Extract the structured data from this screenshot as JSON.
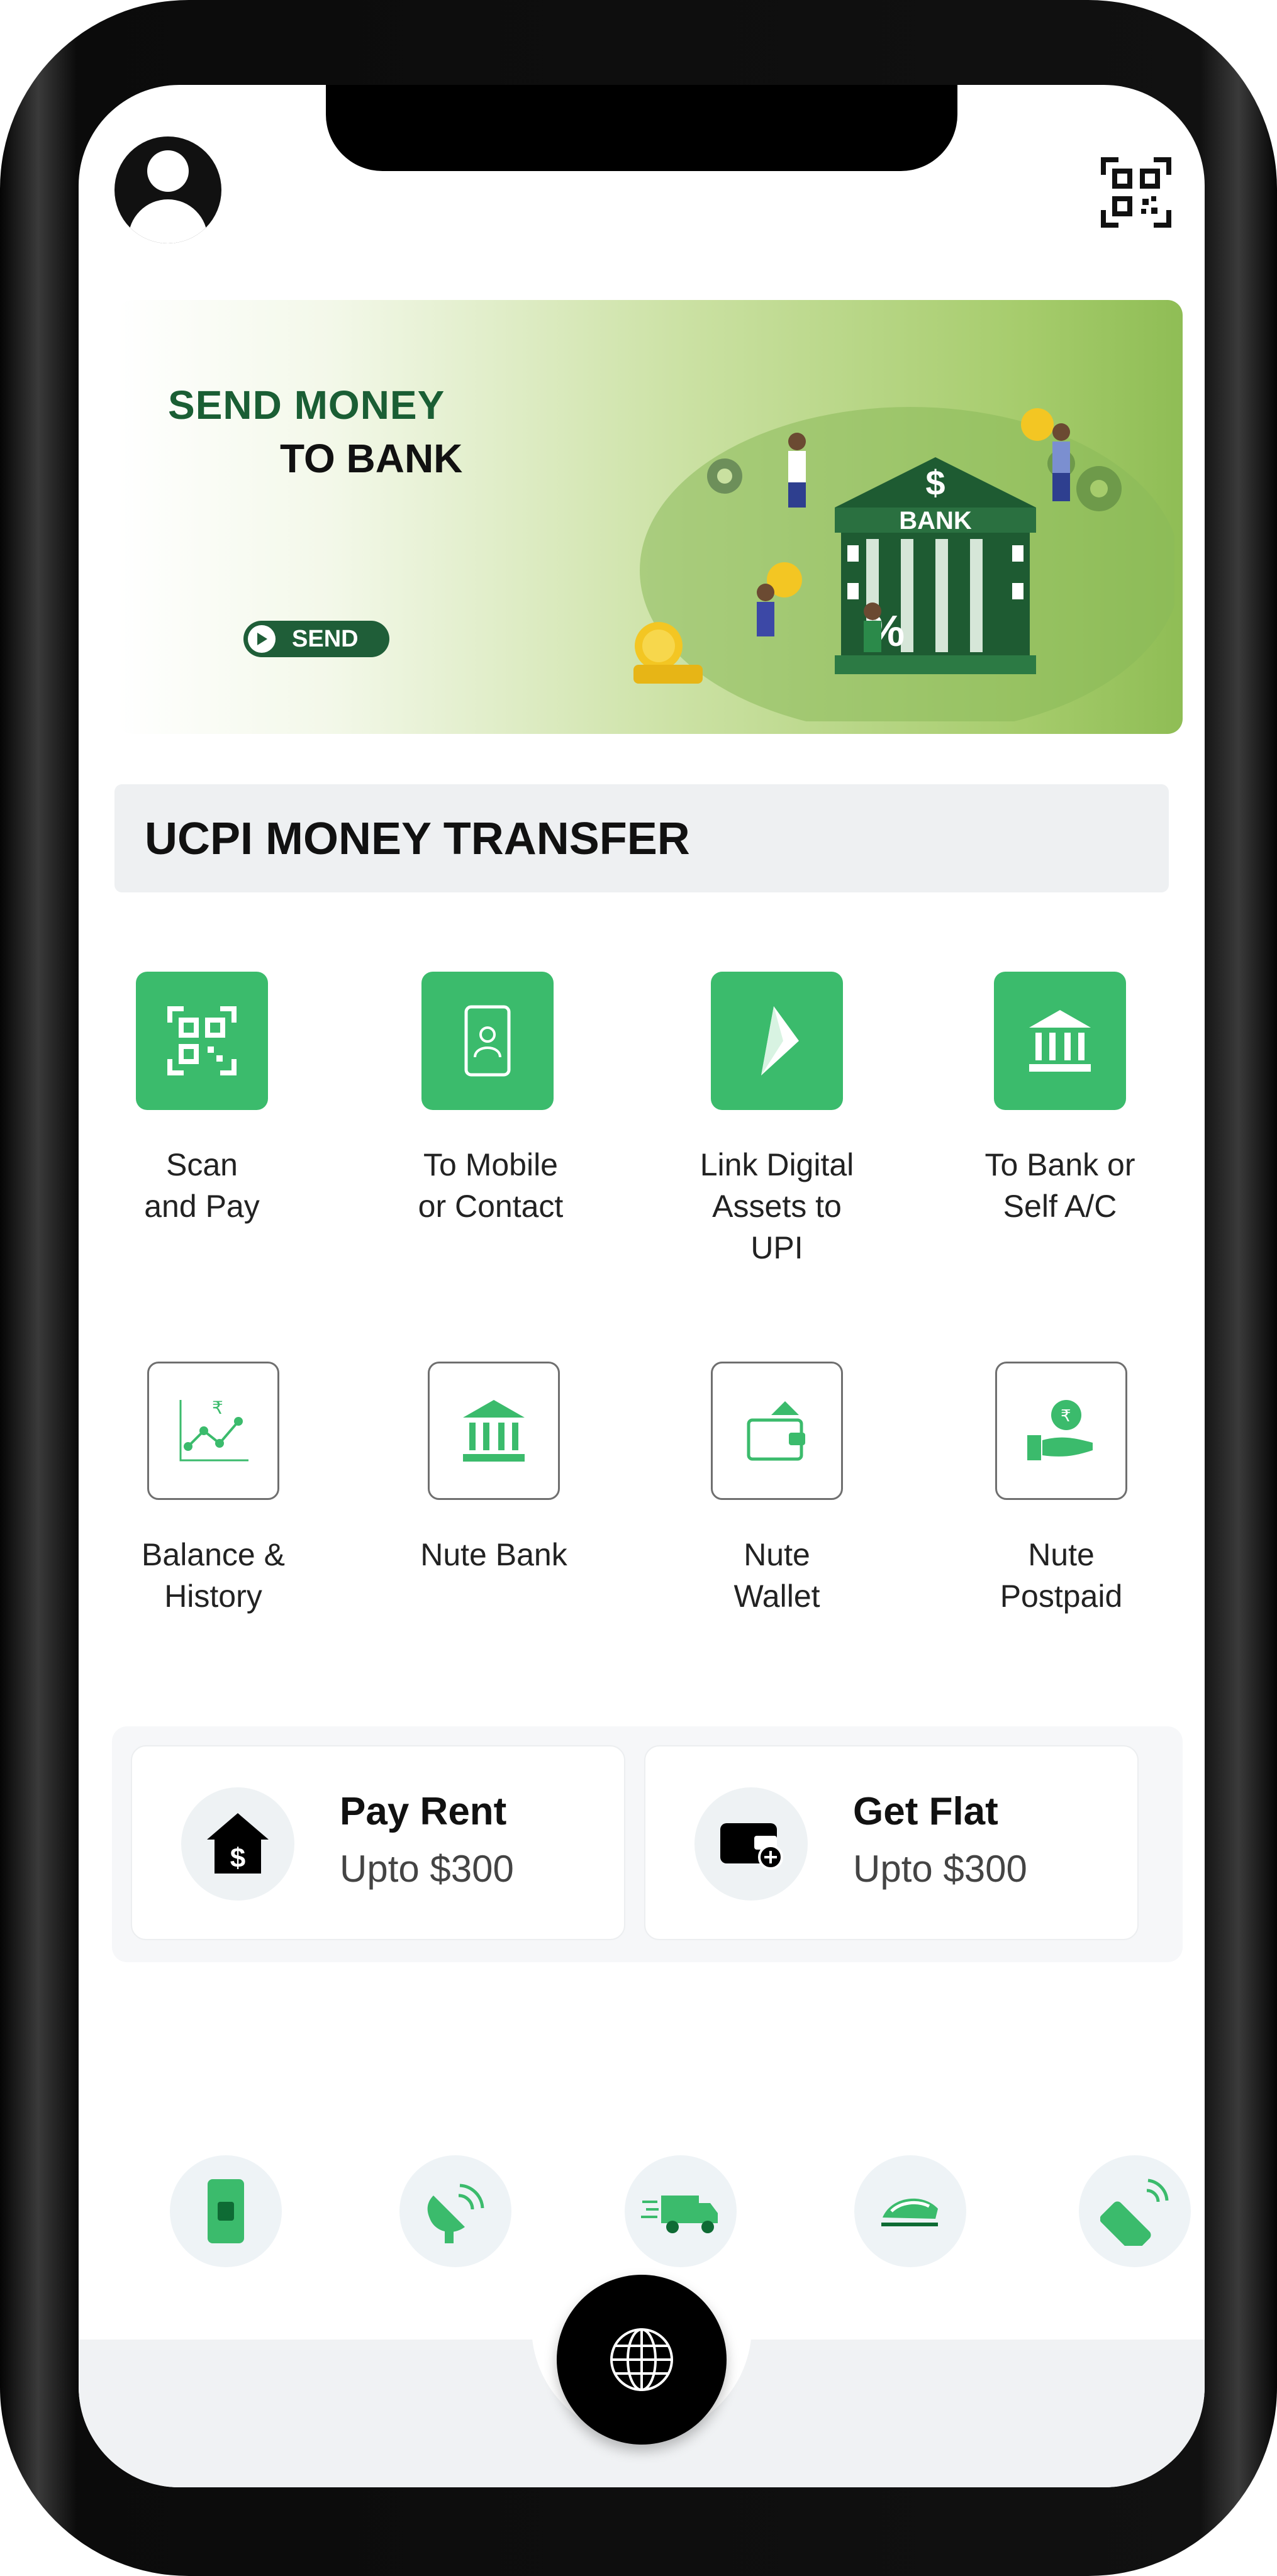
{
  "header": {
    "profile_icon": "profile-icon",
    "qr_icon": "qr-scan-icon"
  },
  "banner": {
    "line1": "SEND MONEY",
    "line2": "TO BANK",
    "button_label": "SEND",
    "bank_sign": "BANK",
    "accent_color": "#1f5e38"
  },
  "section": {
    "title": "UCPI MONEY TRANSFER"
  },
  "services": [
    {
      "label": "Scan and Pay",
      "icon": "qr-code-icon"
    },
    {
      "label": "To Mobile or Contact",
      "icon": "mobile-contact-icon"
    },
    {
      "label": "Link Digital Assets to UPI",
      "icon": "upi-icon"
    },
    {
      "label": "To Bank or Self A/C",
      "icon": "bank-icon"
    },
    {
      "label": "Balance & History",
      "icon": "chart-icon"
    },
    {
      "label": "Nute Bank",
      "icon": "bank-icon"
    },
    {
      "label": "Nute Wallet",
      "icon": "wallet-icon"
    },
    {
      "label": "Nute Postpaid",
      "icon": "rupee-hand-icon"
    }
  ],
  "promos": [
    {
      "title": "Pay Rent",
      "subtitle": "Upto $300",
      "icon": "house-dollar-icon"
    },
    {
      "title": "Get Flat",
      "subtitle": "Upto $300",
      "icon": "wallet-plus-icon"
    }
  ],
  "shortcuts": [
    {
      "icon": "mobile-recharge-icon"
    },
    {
      "icon": "dth-antenna-icon"
    },
    {
      "icon": "delivery-truck-icon"
    },
    {
      "icon": "train-icon"
    },
    {
      "icon": "data-card-icon"
    }
  ],
  "bottom_nav": {
    "icon": "globe-icon"
  },
  "colors": {
    "brand_green": "#3bbb6c",
    "dark_green": "#1f5e38"
  }
}
